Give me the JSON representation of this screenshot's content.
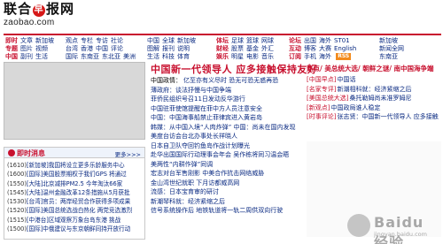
{
  "header": {
    "logo_left": "联合",
    "logo_mark": "早",
    "logo_right": "报网",
    "domain": "zaobao.com"
  },
  "nav": {
    "col1": [
      {
        "head": "即时",
        "links": [
          "文章",
          "新加坡"
        ]
      },
      {
        "head": "专题",
        "links": [
          "图片",
          "视频"
        ]
      },
      {
        "head": "中国",
        "links": [
          "副刊",
          "生活"
        ]
      }
    ],
    "col2": [
      {
        "links": [
          "观点",
          "专栏",
          "专访",
          "社论"
        ]
      },
      {
        "links": [
          "台湾",
          "香港",
          "中国",
          "评论"
        ]
      },
      {
        "links": [
          "国际",
          "东南亚",
          "东北亚",
          "美洲"
        ]
      }
    ],
    "col3": [
      {
        "links": [
          "中国",
          "全球",
          "新加坡"
        ]
      },
      {
        "links": [
          "图解",
          "报刊",
          "说明"
        ]
      },
      {
        "links": [
          "生活",
          "科技",
          "体育"
        ]
      }
    ],
    "col4": [
      {
        "head": "体坛",
        "links": [
          "足球",
          "篮球",
          "网球"
        ]
      },
      {
        "head": "财经",
        "links": [
          "股票",
          "基金",
          "外汇"
        ]
      },
      {
        "head": "娱乐",
        "links": [
          "明星",
          "电影",
          "音乐"
        ]
      }
    ],
    "col5": [
      {
        "head": "论坛",
        "links": [
          "出国",
          "海外",
          "ST01"
        ]
      },
      {
        "head": "互动",
        "links": [
          "博客",
          "大赛",
          "English"
        ]
      },
      {
        "head": "订阅",
        "links": [
          "手机",
          "海外"
        ]
      }
    ],
    "col6": [
      {
        "text": "新加坡"
      },
      {
        "text": "新闻全网"
      },
      {
        "text": "东南亚"
      }
    ],
    "rss": "RSS"
  },
  "headline": {
    "title": "中国新一代领导人 应多接触保持友好",
    "items": [
      {
        "bullet": "中国政情：",
        "text": "亿至亦有义尽时 恐无可恐无惑再恐"
      },
      {
        "bullet": "",
        "text": "薄政府：谈法抒慢与中国争端"
      },
      {
        "bullet": "",
        "text": "菲侨民组织号召11日发动反华游行"
      },
      {
        "bullet": "",
        "text": "中国驻菲使馆提醒在菲中方人员注意安全"
      },
      {
        "bullet": "",
        "text": "中国：中国海事船禁止菲律宾进入黄岩岛"
      },
      {
        "bullet": "",
        "text": "韩媒：从中国入境“人肉炸弹” 中国：尚未在国内发现"
      },
      {
        "bullet": "",
        "text": "美度台访会台北办事处长祥晓人"
      },
      {
        "bullet": "",
        "text": "日本自卫队夺回钓鱼岛作战计划曝光"
      },
      {
        "bullet": "",
        "text": "赴华出国国际行动理事会年会 吴作栋将同习温会晤"
      },
      {
        "bullet": "",
        "text": "美两性“内耕作弹”同调"
      },
      {
        "bullet": "",
        "text": "宏志对台军售刚影 中美合作抗击网络威胁"
      },
      {
        "bullet": "",
        "text": "金山湾世纪就职 下月访都威高网"
      },
      {
        "bullet": "",
        "text": "流感：日本宝育审的研讨"
      },
      {
        "bullet": "",
        "text": "新潮琴科就：经济紧缩之后"
      },
      {
        "bullet": "",
        "text": "信号系统操作后 地铁轨道将一轨二周供双向行驶"
      }
    ]
  },
  "right_column": {
    "title": "热点/ 美总统大选/ 朝鲜之谜/ 南中国海争端",
    "items": [
      {
        "tag": "[中国早点]",
        "text": "中国话"
      },
      {
        "tag": "[名家专评]",
        "text": "新潮相科就：经济紧缩之后"
      },
      {
        "tag": "[美国总统大选]",
        "text": "桑托勒姆尚未准罗姆尼"
      },
      {
        "tag": "[新观点]",
        "text": "中国政局谁人稳定"
      },
      {
        "tag": "[时事评论]",
        "text": "张志贤：中国新一代领导人 应多接触"
      }
    ]
  },
  "jishi": {
    "title": "即时消息",
    "more": "更多>>>",
    "items": [
      {
        "time": "(1610)",
        "text": "[新加坡]我国将设立更多乐龄服务中心"
      },
      {
        "time": "(1600)",
        "text": "[国际]美国股票期权于我们GPS 将通过"
      },
      {
        "time": "(1550)",
        "text": "[大陆]北京减排PM2.5 今年淘汰66家"
      },
      {
        "time": "(1545)",
        "text": "[大陆]温州金融改革12条措施从5月获批"
      },
      {
        "time": "(1530)",
        "text": "[台湾]官员：两岸经贸合作获得多项成果"
      },
      {
        "time": "(1520)",
        "text": "[国际]美国总统选战白热化 两党竞选激烈"
      },
      {
        "time": "(1515)",
        "text": "[中港台]区域观察万象台岛东港 挑战"
      },
      {
        "time": "(1500)",
        "text": "[国际]中俄建议与东京朝鲜同持开放行动"
      }
    ]
  },
  "watermark": {
    "text": "Baidu 经验",
    "url": "jingyan.baidu.com"
  }
}
